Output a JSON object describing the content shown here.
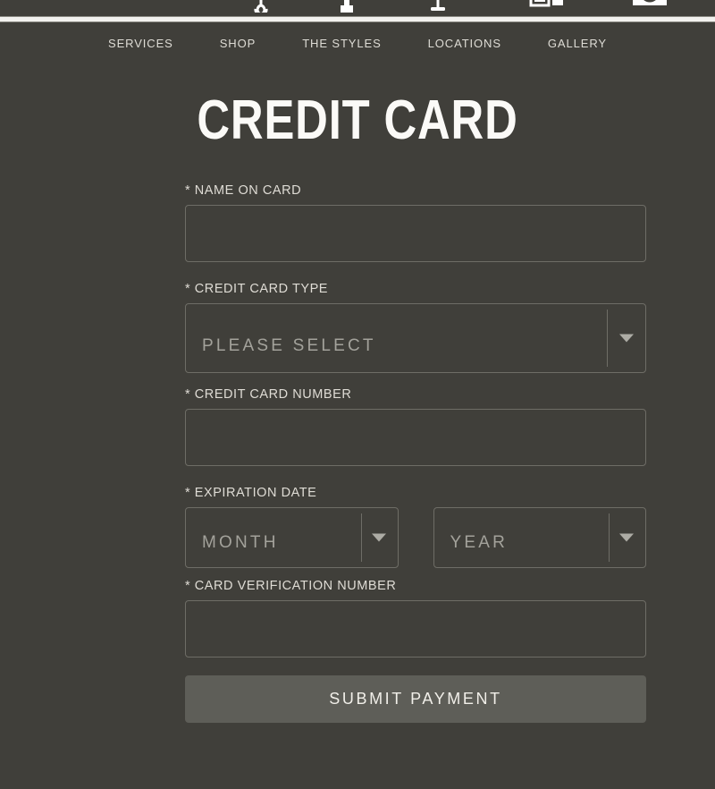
{
  "site": {
    "background_color": "#403f3a",
    "accent_color": "#5e5e58",
    "divider_color": "#f2f1ee"
  },
  "header": {
    "icons": [
      {
        "name": "scissors-icon",
        "for": "SERVICES"
      },
      {
        "name": "bottle-icon",
        "for": "SHOP"
      },
      {
        "name": "razor-icon",
        "for": "THE STYLES"
      },
      {
        "name": "map-pin-icon",
        "for": "LOCATIONS"
      },
      {
        "name": "camera-icon",
        "for": "GALLERY"
      }
    ],
    "nav": [
      {
        "label": "SERVICES"
      },
      {
        "label": "SHOP"
      },
      {
        "label": "THE STYLES"
      },
      {
        "label": "LOCATIONS"
      },
      {
        "label": "GALLERY"
      }
    ]
  },
  "main": {
    "title": "CREDIT CARD",
    "fields": {
      "name_on_card": {
        "label": "* NAME ON CARD",
        "value": "",
        "placeholder": ""
      },
      "credit_card_type": {
        "label": "* CREDIT CARD TYPE",
        "selected": "PLEASE SELECT",
        "options": [
          "PLEASE SELECT"
        ]
      },
      "credit_card_number": {
        "label": "* CREDIT CARD NUMBER",
        "value": "",
        "placeholder": ""
      },
      "expiration_date": {
        "label": "* EXPIRATION DATE",
        "month": {
          "selected": "MONTH",
          "options": [
            "MONTH"
          ]
        },
        "year": {
          "selected": "YEAR",
          "options": [
            "YEAR"
          ]
        }
      },
      "card_verification_number": {
        "label": "* CARD VERIFICATION NUMBER",
        "value": "",
        "placeholder": ""
      }
    },
    "submit_label": "SUBMIT PAYMENT"
  }
}
